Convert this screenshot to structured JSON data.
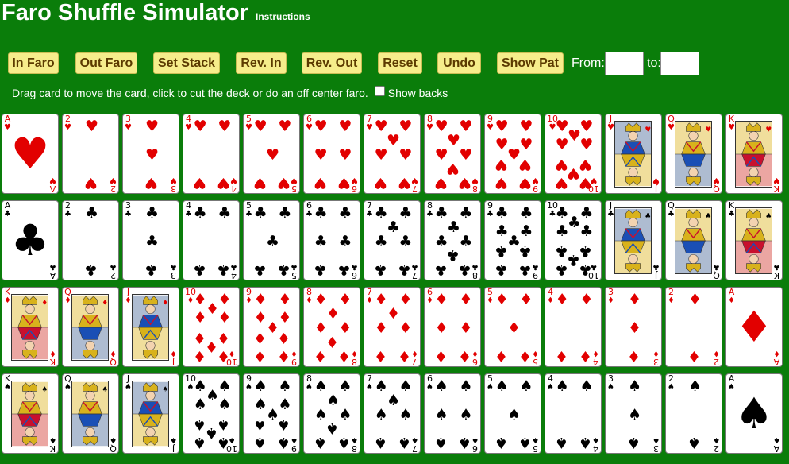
{
  "title": "Faro Shuffle Simulator",
  "instructions_link": "Instructions",
  "buttons": [
    {
      "label": "In Faro",
      "name": "in-faro-button"
    },
    {
      "label": "Out Faro",
      "name": "out-faro-button"
    },
    {
      "label": "Set Stack",
      "name": "set-stack-button"
    },
    {
      "label": "Rev. In",
      "name": "rev-in-button"
    },
    {
      "label": "Rev. Out",
      "name": "rev-out-button"
    },
    {
      "label": "Reset",
      "name": "reset-button"
    },
    {
      "label": "Undo",
      "name": "undo-button"
    },
    {
      "label": "Show Pat",
      "name": "show-pat-button"
    }
  ],
  "from_label": "From:",
  "from_value": "",
  "to_label": "to:",
  "to_value": "",
  "hint": "Drag card to move the card, click to cut the deck or do an off center faro.",
  "show_backs_label": "Show backs",
  "show_backs_checked": false,
  "colors": {
    "table": "#0a7d0a",
    "button": "#f6ed8b",
    "button_text": "#5b3a00",
    "red_suit": "#e20000",
    "black_suit": "#000000"
  },
  "rows": [
    {
      "suit": "hearts",
      "symbol": "♥",
      "color": "red",
      "ranks": [
        "A",
        "2",
        "3",
        "4",
        "5",
        "6",
        "7",
        "8",
        "9",
        "10",
        "J",
        "Q",
        "K"
      ]
    },
    {
      "suit": "clubs",
      "symbol": "♣",
      "color": "black",
      "ranks": [
        "A",
        "2",
        "3",
        "4",
        "5",
        "6",
        "7",
        "8",
        "9",
        "10",
        "J",
        "Q",
        "K"
      ]
    },
    {
      "suit": "diamonds",
      "symbol": "♦",
      "color": "red",
      "ranks": [
        "K",
        "Q",
        "J",
        "10",
        "9",
        "8",
        "7",
        "6",
        "5",
        "4",
        "3",
        "2",
        "A"
      ]
    },
    {
      "suit": "spades",
      "symbol": "♠",
      "color": "black",
      "ranks": [
        "K",
        "Q",
        "J",
        "10",
        "9",
        "8",
        "7",
        "6",
        "5",
        "4",
        "3",
        "2",
        "A"
      ]
    }
  ]
}
